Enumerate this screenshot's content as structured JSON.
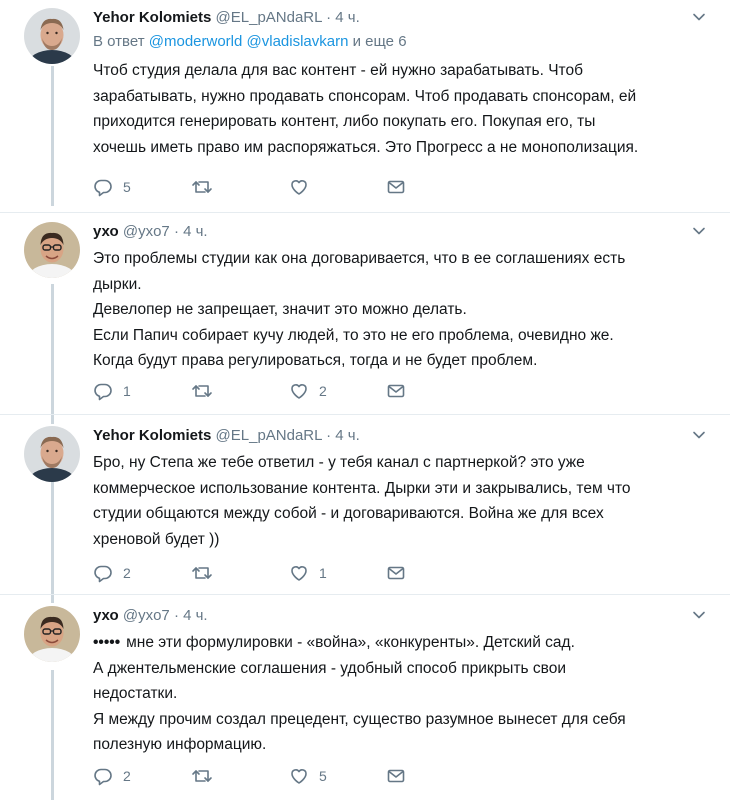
{
  "tweets": [
    {
      "author_name": "Yehor Kolomiets",
      "handle": "@EL_pANdaRL",
      "dot": "·",
      "time": "4 ч.",
      "reply_prefix": "В ответ",
      "reply_mention_1": "@moderworld",
      "reply_mention_2": "@vladislavkarn",
      "reply_suffix": "и еще 6",
      "lines": [
        "Чтоб студия делала для вас контент - ей нужно зарабатывать. Чтоб",
        "зарабатывать, нужно продавать спонсорам. Чтоб продавать спонсорам, ей",
        "приходится генерировать контент, либо покупать его. Покупая его, ты",
        "хочешь иметь право им распоряжаться. Это Прогресс а не монополизация."
      ],
      "replies": "5",
      "retweets": "",
      "likes": ""
    },
    {
      "author_name": "ухо",
      "handle": "@yxo7",
      "dot": "·",
      "time": "4 ч.",
      "lines": [
        "Это проблемы студии как она договаривается, что в ее соглашениях есть",
        "дырки.",
        "Девелопер не запрещает, значит это можно делать.",
        "Если Папич собирает кучу людей, то это не его проблема, очевидно же.",
        "Когда будут права регулироваться, тогда и не будет проблем."
      ],
      "replies": "1",
      "retweets": "",
      "likes": "2"
    },
    {
      "author_name": "Yehor Kolomiets",
      "handle": "@EL_pANdaRL",
      "dot": "·",
      "time": "4 ч.",
      "lines": [
        "Бро, ну Степа же тебе ответил - у тебя канал с партнеркой? это уже",
        "коммерческое использование контента. Дырки эти и закрывались, тем что",
        "студии общаются между собой - и договариваются. Война же для всех",
        "хреновой будет ))"
      ],
      "replies": "2",
      "retweets": "",
      "likes": "1"
    },
    {
      "author_name": "ухо",
      "handle": "@yxo7",
      "dot": "·",
      "time": "4 ч.",
      "redacted": "•••••",
      "first_line_rest": "мне эти формулировки - «война», «конкуренты». Детский сад.",
      "lines": [
        "А джентельменские соглашения - удобный способ прикрыть свои",
        "недостатки.",
        "Я между прочим создал прецедент, существо разумное вынесет для себя",
        "полезную информацию."
      ],
      "replies": "2",
      "retweets": "",
      "likes": "5"
    }
  ],
  "icons": {
    "reply": "reply-icon",
    "retweet": "retweet-icon",
    "like": "heart-icon",
    "dm": "envelope-icon",
    "more": "chevron-down-icon"
  },
  "colors": {
    "text": "#14171a",
    "secondary": "#657786",
    "link": "#1b95e0",
    "thread": "#ccd6dd",
    "divider": "#e6ecf0"
  }
}
